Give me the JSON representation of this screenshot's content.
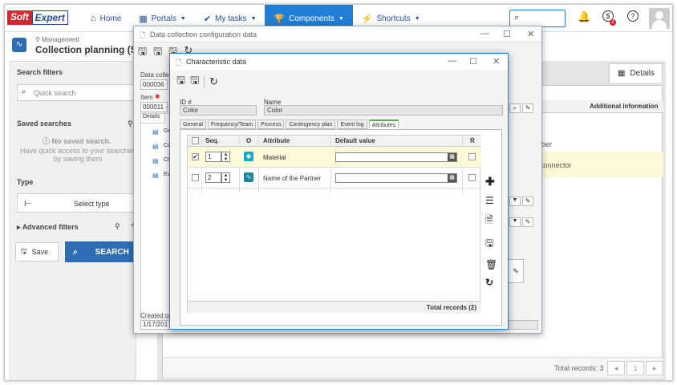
{
  "brand": {
    "soft": "Soft",
    "expert": "Expert",
    "soft_color": "#d7262f",
    "expert_color": "#1e4e9c"
  },
  "nav": [
    {
      "label": "Home",
      "icon": "home-icon"
    },
    {
      "label": "Portals",
      "icon": "portals-icon"
    },
    {
      "label": "My tasks",
      "icon": "check-icon"
    },
    {
      "label": "Components",
      "icon": "trophy-icon",
      "active": true
    },
    {
      "label": "Shortcuts",
      "icon": "bolt-icon"
    }
  ],
  "notification_badge": "2",
  "page": {
    "breadcrumb": "Management",
    "title": "Collection planning (SP0"
  },
  "left": {
    "header": "Search filters",
    "quick_search": "Quick search",
    "saved_searches": "Saved searches",
    "no_saved": "No saved search.",
    "no_saved_hint": "Have quick access to your searches by saving them",
    "type": "Type",
    "select_type": "Select type",
    "advanced_filters": "Advanced filters",
    "save": "Save",
    "search": "SEARCH"
  },
  "right": {
    "details_tab": "Details",
    "column_header": "Additional information",
    "row1": "iber",
    "row2": "connector",
    "total_records": "Total records: 3",
    "page": "1"
  },
  "dialog1": {
    "title": "Data collection configuration data",
    "label_collection": "Data collec",
    "value_collection": "000036",
    "label_item": "Item",
    "value_item": "000011 -",
    "tree_tab": "Details",
    "tree_items": [
      "Ge",
      "Co",
      "Ch",
      "Ev"
    ],
    "created_label": "Created on",
    "created_value": "1/17/201"
  },
  "dialog2": {
    "title": "Characteristic data",
    "id_label": "ID #",
    "id_value": "Color",
    "name_label": "Name",
    "name_value": "Color",
    "tabs": [
      "General",
      "Frequency/Team",
      "Process",
      "Contingency plan",
      "Event log",
      "Attributes"
    ],
    "active_tab": "Attributes",
    "grid_headers": {
      "seq": "Seq.",
      "o": "O",
      "attribute": "Attribute",
      "default": "Default value",
      "r": "R"
    },
    "rows": [
      {
        "seq": "1",
        "attribute": "Material",
        "checked": true,
        "icon_color": "#1aa6c8"
      },
      {
        "seq": "2",
        "attribute": "Name of the Partner",
        "checked": false,
        "icon_color": "#1a8a9a"
      }
    ],
    "total_records": "Total records (2)"
  }
}
